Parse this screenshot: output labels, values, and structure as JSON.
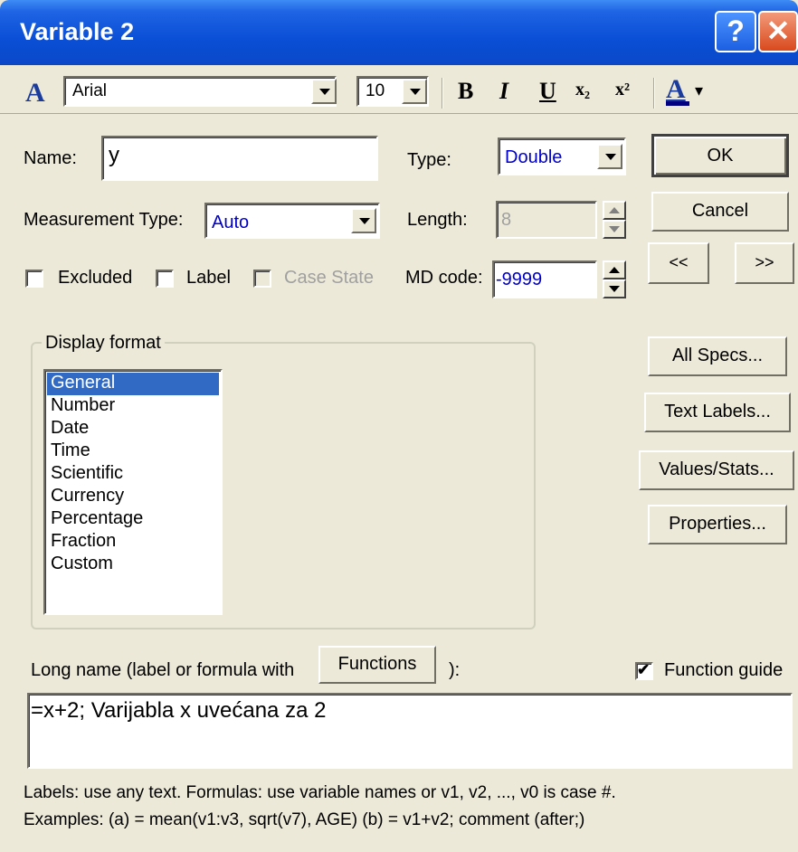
{
  "window": {
    "title": "Variable 2",
    "help_glyph": "?",
    "close_glyph": "✕"
  },
  "toolbar": {
    "font_icon_glyph": "A",
    "font_name": "Arial",
    "font_size": "10",
    "bold": "B",
    "italic": "I",
    "underline": "U",
    "subscript": "x₂",
    "superscript": "x²",
    "font_color_glyph": "A",
    "font_color_dropdown": "▾"
  },
  "fields": {
    "name_label": "Name:",
    "name_value": "y",
    "type_label": "Type:",
    "type_value": "Double",
    "measurement_label": "Measurement Type:",
    "measurement_value": "Auto",
    "length_label": "Length:",
    "length_value": "8",
    "md_label": "MD code:",
    "md_value": "-9999"
  },
  "checks": {
    "excluded": {
      "label": "Excluded",
      "checked": false
    },
    "label": {
      "label": "Label",
      "checked": false
    },
    "case_state": {
      "label": "Case State",
      "checked": false,
      "disabled": true
    },
    "function_guide": {
      "label": "Function guide",
      "checked": true,
      "mark": "✔"
    }
  },
  "buttons": {
    "ok": "OK",
    "cancel": "Cancel",
    "prev": "<<",
    "next": ">>",
    "all_specs": "All Specs...",
    "text_labels": "Text Labels...",
    "values_stats": "Values/Stats...",
    "properties": "Properties...",
    "functions": "Functions"
  },
  "display_format": {
    "legend": "Display format",
    "items": [
      "General",
      "Number",
      "Date",
      "Time",
      "Scientific",
      "Currency",
      "Percentage",
      "Fraction",
      "Custom"
    ],
    "selected": "General"
  },
  "long_name": {
    "label_prefix": "Long name (label or formula with",
    "label_suffix": "):",
    "value": "=x+2; Varijabla x uvećana za 2"
  },
  "help": {
    "line1": "Labels: use any text.  Formulas: use variable names or v1, v2, ..., v0 is case #.",
    "line2": "Examples:   (a) = mean(v1:v3, sqrt(v7), AGE)   (b) = v1+v2; comment (after;)"
  },
  "colors": {
    "title_bar": "#0b48c8",
    "selection": "#316ac5",
    "dialog_bg": "#ece9d8",
    "font_color_bar": "#000080"
  }
}
